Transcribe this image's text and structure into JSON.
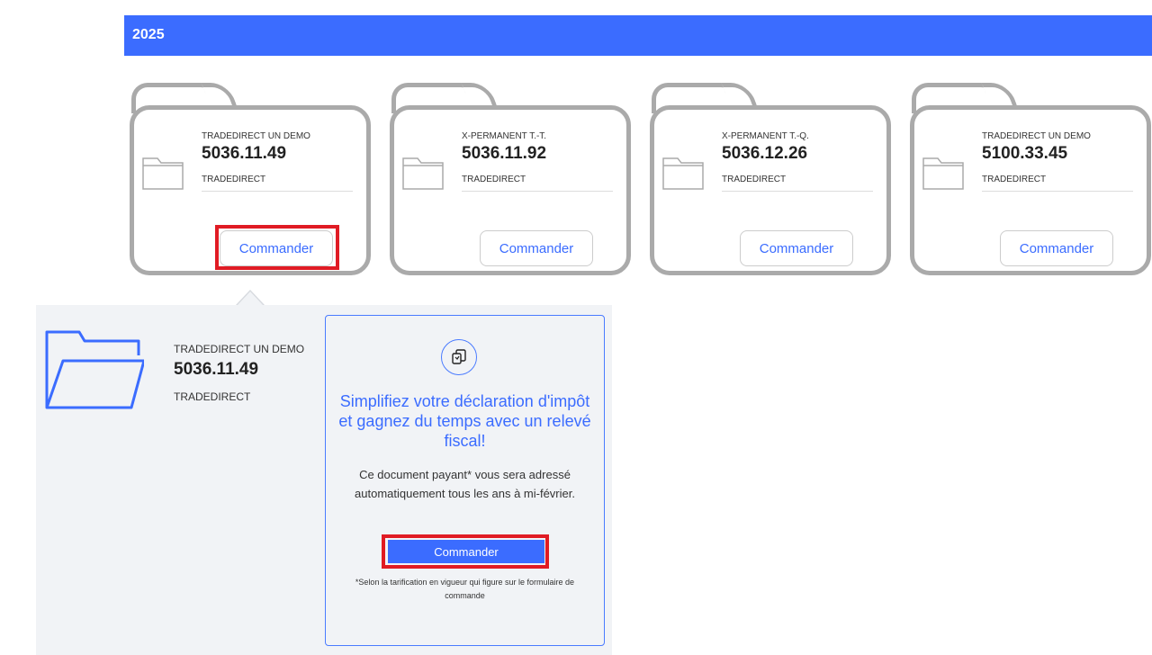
{
  "section": {
    "year": "2025"
  },
  "accounts": [
    {
      "type": "TRADEDIRECT UN DEMO",
      "number": "5036.11.49",
      "product": "TRADEDIRECT",
      "button": "Commander"
    },
    {
      "type": "X-PERMANENT T.-T.",
      "number": "5036.11.92",
      "product": "TRADEDIRECT",
      "button": "Commander"
    },
    {
      "type": "X-PERMANENT T.-Q.",
      "number": "5036.12.26",
      "product": "TRADEDIRECT",
      "button": "Commander"
    },
    {
      "type": "TRADEDIRECT UN DEMO",
      "number": "5100.33.45",
      "product": "TRADEDIRECT",
      "button": "Commander"
    }
  ],
  "detail": {
    "type": "TRADEDIRECT UN DEMO",
    "number": "5036.11.49",
    "product": "TRADEDIRECT",
    "promo": {
      "icon": "copy-documents-icon",
      "title": "Simplifiez votre déclaration d'impôt et gagnez du temps avec un relevé fiscal!",
      "description": "Ce document payant* vous sera adressé automatiquement tous les ans à mi-février.",
      "button": "Commander",
      "footnote": "*Selon la tarification en vigueur qui figure sur le formulaire de commande"
    }
  },
  "colors": {
    "accent": "#3b6cff",
    "highlight": "#e01b24",
    "panel": "#f1f3f6",
    "folder": "#aaaaaa"
  }
}
